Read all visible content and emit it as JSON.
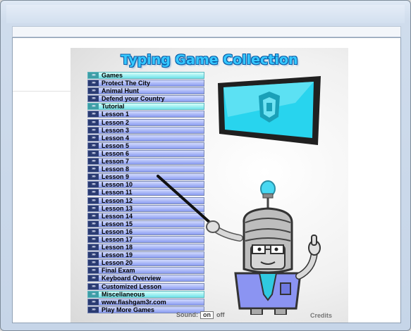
{
  "game": {
    "title": "Typing Game Collection",
    "menu": [
      {
        "label": "Games",
        "kind": "header"
      },
      {
        "label": "Protect The City",
        "kind": "item"
      },
      {
        "label": "Animal Hunt",
        "kind": "item"
      },
      {
        "label": "Defend your Country",
        "kind": "item"
      },
      {
        "label": "Tutorial",
        "kind": "header"
      },
      {
        "label": "Lesson 1",
        "kind": "item"
      },
      {
        "label": "Lesson 2",
        "kind": "item"
      },
      {
        "label": "Lesson 3",
        "kind": "item"
      },
      {
        "label": "Lesson 4",
        "kind": "item"
      },
      {
        "label": "Lesson 5",
        "kind": "item"
      },
      {
        "label": "Lesson 6",
        "kind": "item"
      },
      {
        "label": "Lesson 7",
        "kind": "item"
      },
      {
        "label": "Lesson 8",
        "kind": "item"
      },
      {
        "label": "Lesson 9",
        "kind": "item"
      },
      {
        "label": "Lesson 10",
        "kind": "item"
      },
      {
        "label": "Lesson 11",
        "kind": "item"
      },
      {
        "label": "Lesson 12",
        "kind": "item"
      },
      {
        "label": "Lesson 13",
        "kind": "item"
      },
      {
        "label": "Lesson 14",
        "kind": "item"
      },
      {
        "label": "Lesson 15",
        "kind": "item"
      },
      {
        "label": "Lesson 16",
        "kind": "item"
      },
      {
        "label": "Lesson 17",
        "kind": "item"
      },
      {
        "label": "Lesson 18",
        "kind": "item"
      },
      {
        "label": "Lesson 19",
        "kind": "item"
      },
      {
        "label": "Lesson 20",
        "kind": "item"
      },
      {
        "label": "Final Exam",
        "kind": "item"
      },
      {
        "label": "Keyboard Overview",
        "kind": "item"
      },
      {
        "label": "Customized Lesson",
        "kind": "item"
      },
      {
        "label": "Miscellaneous",
        "kind": "header"
      },
      {
        "label": "www.flashgam3r.com",
        "kind": "item"
      },
      {
        "label": "Play More Games",
        "kind": "item"
      }
    ],
    "sound": {
      "label": "Sound:",
      "on": "on",
      "off": "off"
    },
    "credits": "Credits"
  },
  "colors": {
    "title": "#36c8ff",
    "menu_item": "#8a9cf1",
    "menu_header": "#71e3ea",
    "screen": "#2fd6ee"
  }
}
